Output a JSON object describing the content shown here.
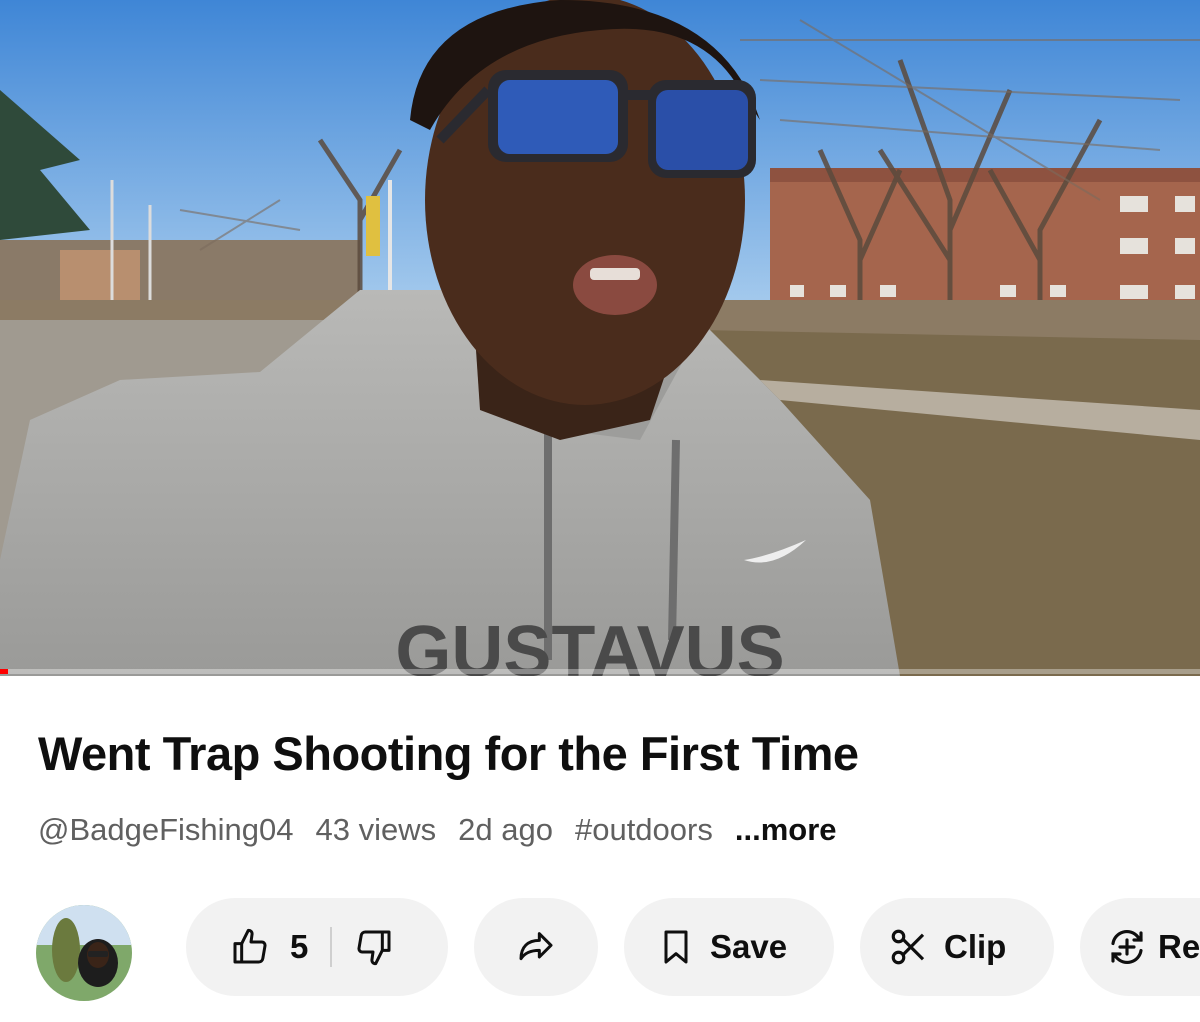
{
  "video": {
    "hoodie_text": "GUSTAVUS",
    "progress_fraction": 0.007,
    "colors": {
      "sky": "#6fa8e3",
      "hoodie": "#a9a9a7",
      "brick": "#a5654d",
      "grass": "#7d6b4c",
      "progress": "#ff0000"
    }
  },
  "details": {
    "title": "Went Trap Shooting for the First Time",
    "channel_handle": "@BadgeFishing04",
    "views": "43 views",
    "age": "2d ago",
    "hashtag": "#outdoors",
    "more_label": "...more"
  },
  "actions": {
    "like_count": "5",
    "save_label": "Save",
    "clip_label": "Clip",
    "remix_label": "Re",
    "icons": [
      "thumbs-up-icon",
      "thumbs-down-icon",
      "share-icon",
      "bookmark-icon",
      "scissors-icon",
      "remix-icon"
    ]
  }
}
